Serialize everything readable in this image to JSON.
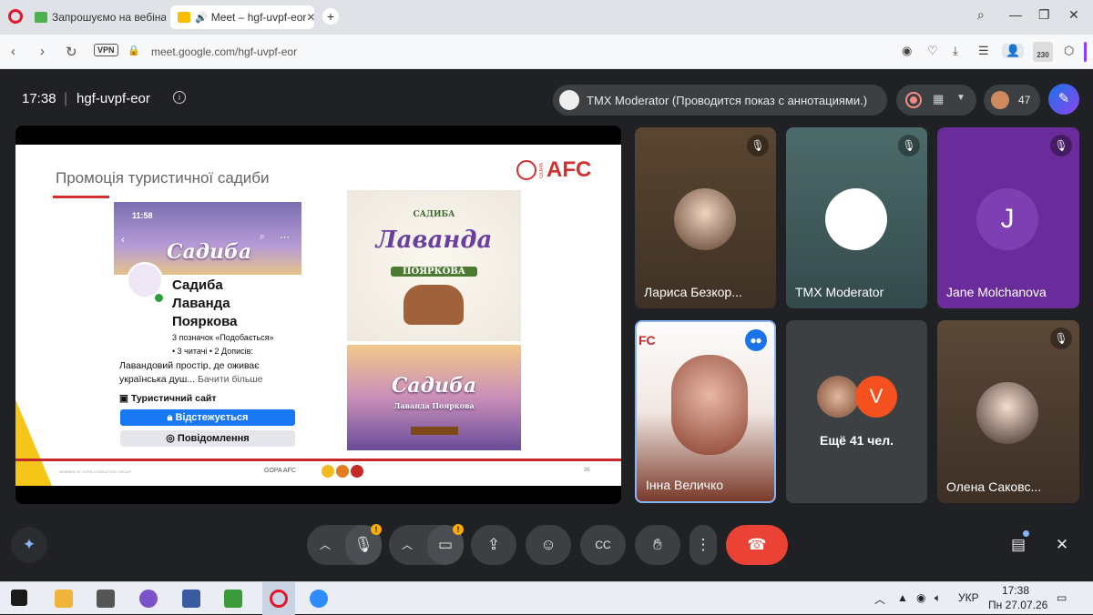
{
  "browser": {
    "tabs": [
      {
        "label": "Запрошуємо на вебінар"
      },
      {
        "label": "Meet – hgf-uvpf-eor"
      }
    ],
    "vpn_label": "VPN",
    "url": "meet.google.com/hgf-uvpf-eor",
    "badge_count": "230"
  },
  "meet": {
    "time": "17:38",
    "code": "hgf-uvpf-eor",
    "presenter_text": "TMX Moderator (Проводится показ с аннотациями.)",
    "participant_count": "47",
    "tiles": [
      {
        "name": "Лариса Безкор..."
      },
      {
        "name": "TMX Moderator"
      },
      {
        "name": "Jane Molchanova",
        "initial": "J"
      },
      {
        "name": "Інна Величко"
      },
      {
        "name": "Ещё 41 чел.",
        "initial": "V"
      },
      {
        "name": "Олена Саковс..."
      }
    ]
  },
  "slide": {
    "title": "Промоція туристичної садиби",
    "brand": "AFC",
    "brand_small": "GOPA",
    "phone_time": "11:58",
    "brand_script": "Садиба",
    "profile_name_1": "Садиба",
    "profile_name_2": "Лаванда",
    "profile_name_3": "Пояркова",
    "stats_1": "3 позначок «Подобається»",
    "stats_2": "• 3 читачі • 2 Дописів:",
    "bio": "Лавандовий простір, де оживає українська душ...",
    "bio_more": "Бачити більше",
    "site": "Туристичний сайт",
    "follow_btn": "Відстежується",
    "message_btn": "Повідомлення",
    "logo_line1": "САДИБА",
    "logo_line2": "Лаванда",
    "logo_line3": "ПОЯРКОВА",
    "img2_line1": "Садиба",
    "img2_line2": "Лаванда Пояркова",
    "footer": "GOPA AFC",
    "page_no": "36",
    "footer_small": "MEMBER OF GOPA CONSULTING GROUP"
  },
  "taskbar": {
    "lang": "УКР",
    "time": "17:38",
    "date": "Пн 27.07.26"
  }
}
